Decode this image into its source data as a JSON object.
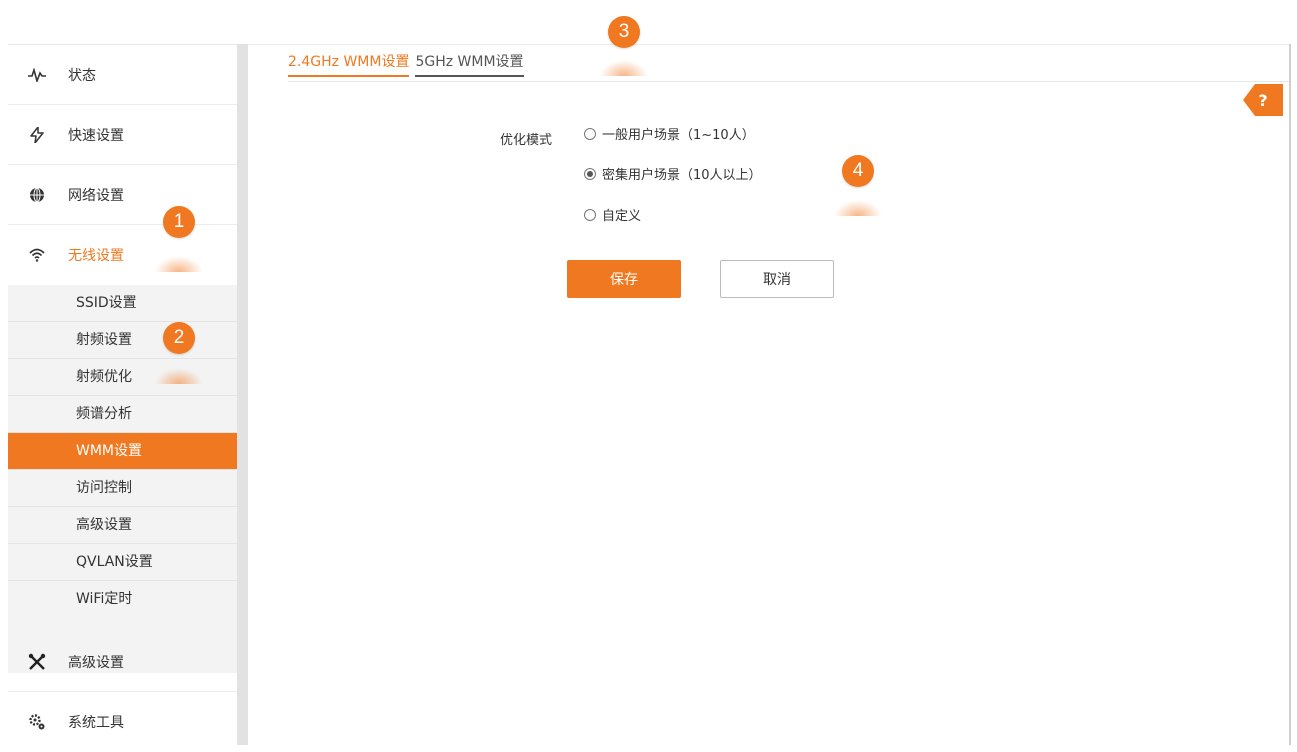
{
  "sidebar": {
    "main_items": [
      {
        "label": "状态",
        "icon": "pulse-icon"
      },
      {
        "label": "快速设置",
        "icon": "lightning-icon"
      },
      {
        "label": "网络设置",
        "icon": "globe-icon"
      },
      {
        "label": "无线设置",
        "icon": "wifi-icon"
      },
      {
        "label": "高级设置",
        "icon": "tools-icon"
      },
      {
        "label": "系统工具",
        "icon": "gear-icon"
      }
    ],
    "sub_items": [
      "SSID设置",
      "射频设置",
      "射频优化",
      "频谱分析",
      "WMM设置",
      "访问控制",
      "高级设置",
      "QVLAN设置",
      "WiFi定时"
    ]
  },
  "tabs": [
    "2.4GHz WMM设置",
    "5GHz WMM设置"
  ],
  "form": {
    "label": "优化模式",
    "options": [
      "一般用户场景（1~10人）",
      "密集用户场景（10人以上）",
      "自定义"
    ]
  },
  "buttons": {
    "save": "保存",
    "cancel": "取消"
  },
  "help": "?",
  "callouts": [
    "1",
    "2",
    "3",
    "4"
  ],
  "colors": {
    "accent": "#f07820",
    "sidebar_sub_bg": "#f3f3f3"
  }
}
